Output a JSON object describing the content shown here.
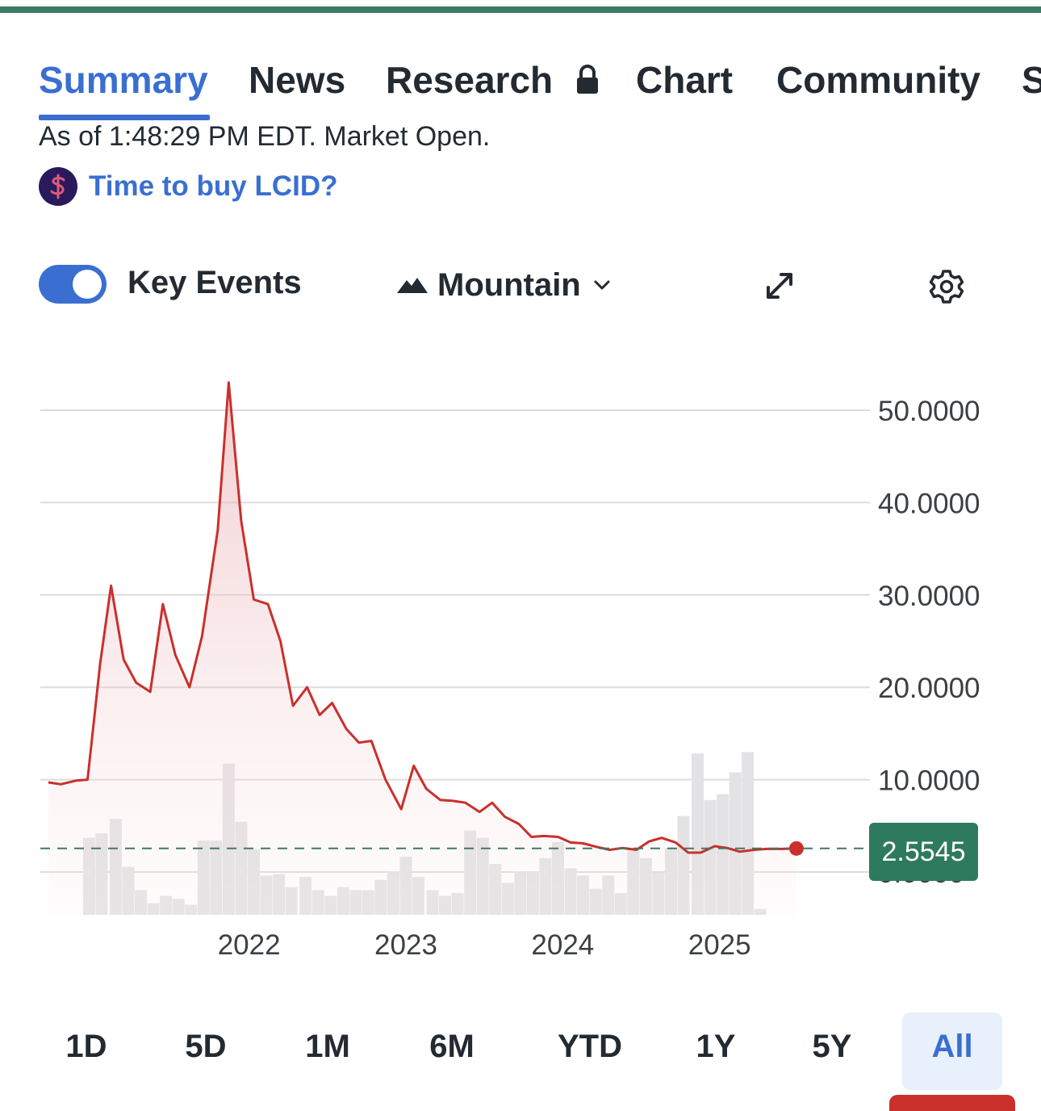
{
  "colors": {
    "accent": "#3a6fd1",
    "price_line": "#c9302c",
    "price_badge": "#2e7a5e",
    "top_bar": "#3c7a62",
    "volume": "#e3e3e5"
  },
  "tabs": [
    {
      "label": "Summary",
      "active": true
    },
    {
      "label": "News"
    },
    {
      "label": "Research",
      "icon": "lock-icon"
    },
    {
      "label": "Chart"
    },
    {
      "label": "Community"
    },
    {
      "label": "S"
    }
  ],
  "status": {
    "as_of": "As of 1:48:29 PM EDT. Market Open."
  },
  "promo": {
    "icon": "dollar-icon",
    "text": "Time to buy LCID?"
  },
  "controls": {
    "key_events_label": "Key Events",
    "key_events_on": true,
    "chart_type_label": "Mountain",
    "expand_icon": "expand-icon",
    "settings_icon": "gear-icon"
  },
  "chart_data": {
    "type": "area",
    "current_price": "2.5545",
    "y_ticks": [
      "50.0000",
      "40.0000",
      "30.0000",
      "20.0000",
      "10.0000",
      "0.0000"
    ],
    "ylim": [
      -3,
      53
    ],
    "x_ticks": [
      {
        "label": "2022",
        "x": 2022.0
      },
      {
        "label": "2023",
        "x": 2023.0
      },
      {
        "label": "2024",
        "x": 2024.0
      },
      {
        "label": "2025",
        "x": 2025.0
      }
    ],
    "xlim": [
      2020.7,
      2025.65
    ],
    "grid": true,
    "price": [
      [
        2020.72,
        9.7
      ],
      [
        2020.8,
        9.5
      ],
      [
        2020.9,
        9.9
      ],
      [
        2020.97,
        10.0
      ],
      [
        2021.05,
        22.5
      ],
      [
        2021.12,
        31.0
      ],
      [
        2021.2,
        23.0
      ],
      [
        2021.28,
        20.5
      ],
      [
        2021.37,
        19.5
      ],
      [
        2021.45,
        29.0
      ],
      [
        2021.53,
        23.5
      ],
      [
        2021.62,
        20.0
      ],
      [
        2021.7,
        25.5
      ],
      [
        2021.8,
        37.0
      ],
      [
        2021.87,
        53.0
      ],
      [
        2021.95,
        38.0
      ],
      [
        2022.03,
        29.5
      ],
      [
        2022.12,
        29.0
      ],
      [
        2022.2,
        25.0
      ],
      [
        2022.28,
        18.0
      ],
      [
        2022.37,
        20.0
      ],
      [
        2022.45,
        17.0
      ],
      [
        2022.53,
        18.3
      ],
      [
        2022.62,
        15.5
      ],
      [
        2022.7,
        14.0
      ],
      [
        2022.78,
        14.2
      ],
      [
        2022.87,
        10.0
      ],
      [
        2022.97,
        6.8
      ],
      [
        2023.05,
        11.5
      ],
      [
        2023.13,
        9.0
      ],
      [
        2023.22,
        7.8
      ],
      [
        2023.3,
        7.7
      ],
      [
        2023.38,
        7.5
      ],
      [
        2023.47,
        6.5
      ],
      [
        2023.55,
        7.5
      ],
      [
        2023.63,
        6.0
      ],
      [
        2023.72,
        5.2
      ],
      [
        2023.8,
        3.8
      ],
      [
        2023.88,
        3.9
      ],
      [
        2023.97,
        3.8
      ],
      [
        2024.05,
        3.2
      ],
      [
        2024.13,
        3.1
      ],
      [
        2024.22,
        2.7
      ],
      [
        2024.3,
        2.4
      ],
      [
        2024.38,
        2.6
      ],
      [
        2024.47,
        2.4
      ],
      [
        2024.55,
        3.3
      ],
      [
        2024.63,
        3.7
      ],
      [
        2024.72,
        3.2
      ],
      [
        2024.8,
        2.1
      ],
      [
        2024.88,
        2.1
      ],
      [
        2024.97,
        2.8
      ],
      [
        2025.05,
        2.6
      ],
      [
        2025.13,
        2.2
      ],
      [
        2025.22,
        2.4
      ],
      [
        2025.3,
        2.5
      ],
      [
        2025.4,
        2.5
      ],
      [
        2025.49,
        2.55
      ]
    ],
    "volume_scale_max": 1.0,
    "volume": [
      [
        2020.98,
        0.53
      ],
      [
        2021.06,
        0.56
      ],
      [
        2021.15,
        0.66
      ],
      [
        2021.23,
        0.33
      ],
      [
        2021.31,
        0.17
      ],
      [
        2021.39,
        0.08
      ],
      [
        2021.47,
        0.13
      ],
      [
        2021.55,
        0.11
      ],
      [
        2021.63,
        0.07
      ],
      [
        2021.71,
        0.51
      ],
      [
        2021.79,
        0.51
      ],
      [
        2021.87,
        1.04
      ],
      [
        2021.95,
        0.64
      ],
      [
        2022.03,
        0.45
      ],
      [
        2022.11,
        0.27
      ],
      [
        2022.19,
        0.28
      ],
      [
        2022.27,
        0.19
      ],
      [
        2022.36,
        0.26
      ],
      [
        2022.44,
        0.17
      ],
      [
        2022.52,
        0.13
      ],
      [
        2022.6,
        0.19
      ],
      [
        2022.68,
        0.17
      ],
      [
        2022.76,
        0.17
      ],
      [
        2022.84,
        0.24
      ],
      [
        2022.92,
        0.3
      ],
      [
        2023.0,
        0.4
      ],
      [
        2023.08,
        0.26
      ],
      [
        2023.17,
        0.17
      ],
      [
        2023.25,
        0.13
      ],
      [
        2023.33,
        0.15
      ],
      [
        2023.41,
        0.58
      ],
      [
        2023.49,
        0.53
      ],
      [
        2023.57,
        0.35
      ],
      [
        2023.65,
        0.22
      ],
      [
        2023.73,
        0.3
      ],
      [
        2023.81,
        0.3
      ],
      [
        2023.89,
        0.39
      ],
      [
        2023.97,
        0.5
      ],
      [
        2024.05,
        0.32
      ],
      [
        2024.13,
        0.27
      ],
      [
        2024.21,
        0.18
      ],
      [
        2024.29,
        0.27
      ],
      [
        2024.37,
        0.15
      ],
      [
        2024.45,
        0.46
      ],
      [
        2024.53,
        0.39
      ],
      [
        2024.61,
        0.29
      ],
      [
        2024.69,
        0.46
      ],
      [
        2024.77,
        0.68
      ],
      [
        2024.86,
        1.11
      ],
      [
        2024.94,
        0.79
      ],
      [
        2025.02,
        0.83
      ],
      [
        2025.1,
        0.98
      ],
      [
        2025.18,
        1.12
      ],
      [
        2025.26,
        0.04
      ]
    ]
  },
  "ranges": [
    {
      "label": "1D"
    },
    {
      "label": "5D"
    },
    {
      "label": "1M"
    },
    {
      "label": "6M"
    },
    {
      "label": "YTD"
    },
    {
      "label": "1Y"
    },
    {
      "label": "5Y"
    },
    {
      "label": "All",
      "active": true
    }
  ]
}
